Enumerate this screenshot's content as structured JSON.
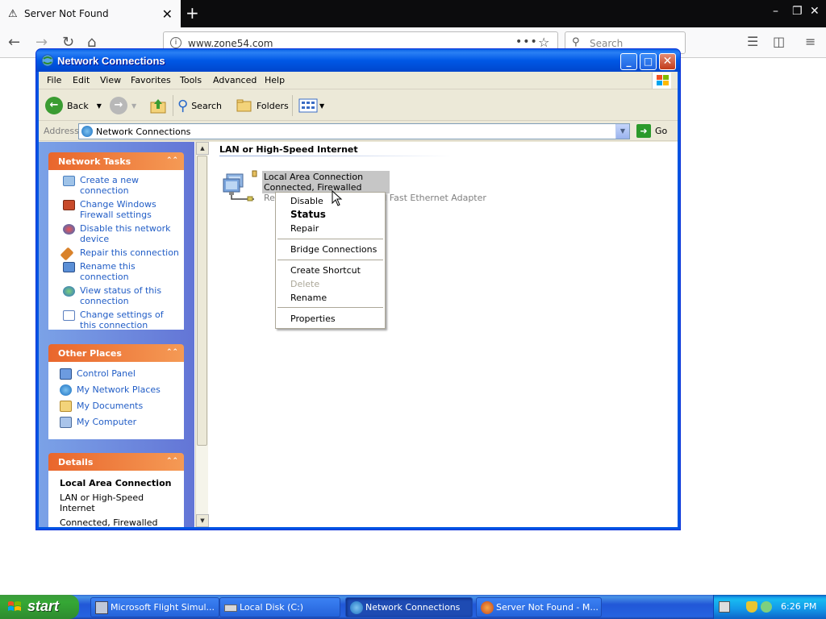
{
  "browser": {
    "tab_title": "Server Not Found",
    "url": "www.zone54.com",
    "search_placeholder": "Search"
  },
  "window": {
    "title": "Network Connections",
    "menu": [
      "File",
      "Edit",
      "View",
      "Favorites",
      "Tools",
      "Advanced",
      "Help"
    ],
    "toolbar": {
      "back": "Back",
      "search": "Search",
      "folders": "Folders"
    },
    "address_label": "Address",
    "address_value": "Network Connections",
    "go_label": "Go"
  },
  "left_pane": {
    "network_tasks": {
      "title": "Network Tasks",
      "items": [
        "Create a new connection",
        "Change Windows Firewall settings",
        "Disable this network device",
        "Repair this connection",
        "Rename this connection",
        "View status of this connection",
        "Change settings of this connection"
      ]
    },
    "other_places": {
      "title": "Other Places",
      "items": [
        "Control Panel",
        "My Network Places",
        "My Documents",
        "My Computer"
      ]
    },
    "details": {
      "title": "Details",
      "name": "Local Area Connection",
      "type": "LAN or High-Speed Internet",
      "status": "Connected, Firewalled"
    }
  },
  "main": {
    "group_header": "LAN or High-Speed Internet",
    "connection": {
      "name": "Local Area Connection",
      "status": "Connected, Firewalled",
      "device": "Realtek RTL8139 Family PCI Fast Ethernet Adapter"
    }
  },
  "context_menu": {
    "items": [
      "Disable",
      "Status",
      "Repair",
      "Bridge Connections",
      "Create Shortcut",
      "Delete",
      "Rename",
      "Properties"
    ],
    "default_item": "Status",
    "disabled_items": [
      "Delete"
    ]
  },
  "taskbar": {
    "start_label": "start",
    "items": [
      "Microsoft Flight Simul...",
      "Local Disk (C:)",
      "Network Connections",
      "Server Not Found - M..."
    ],
    "active_item": "Network Connections",
    "clock": "6:26 PM"
  },
  "colors": {
    "xp_title_blue": "#0054e3",
    "task_header_orange": "#e9662c",
    "link_blue": "#215dc6",
    "taskbar_blue": "#245edb",
    "start_green": "#35a835"
  }
}
